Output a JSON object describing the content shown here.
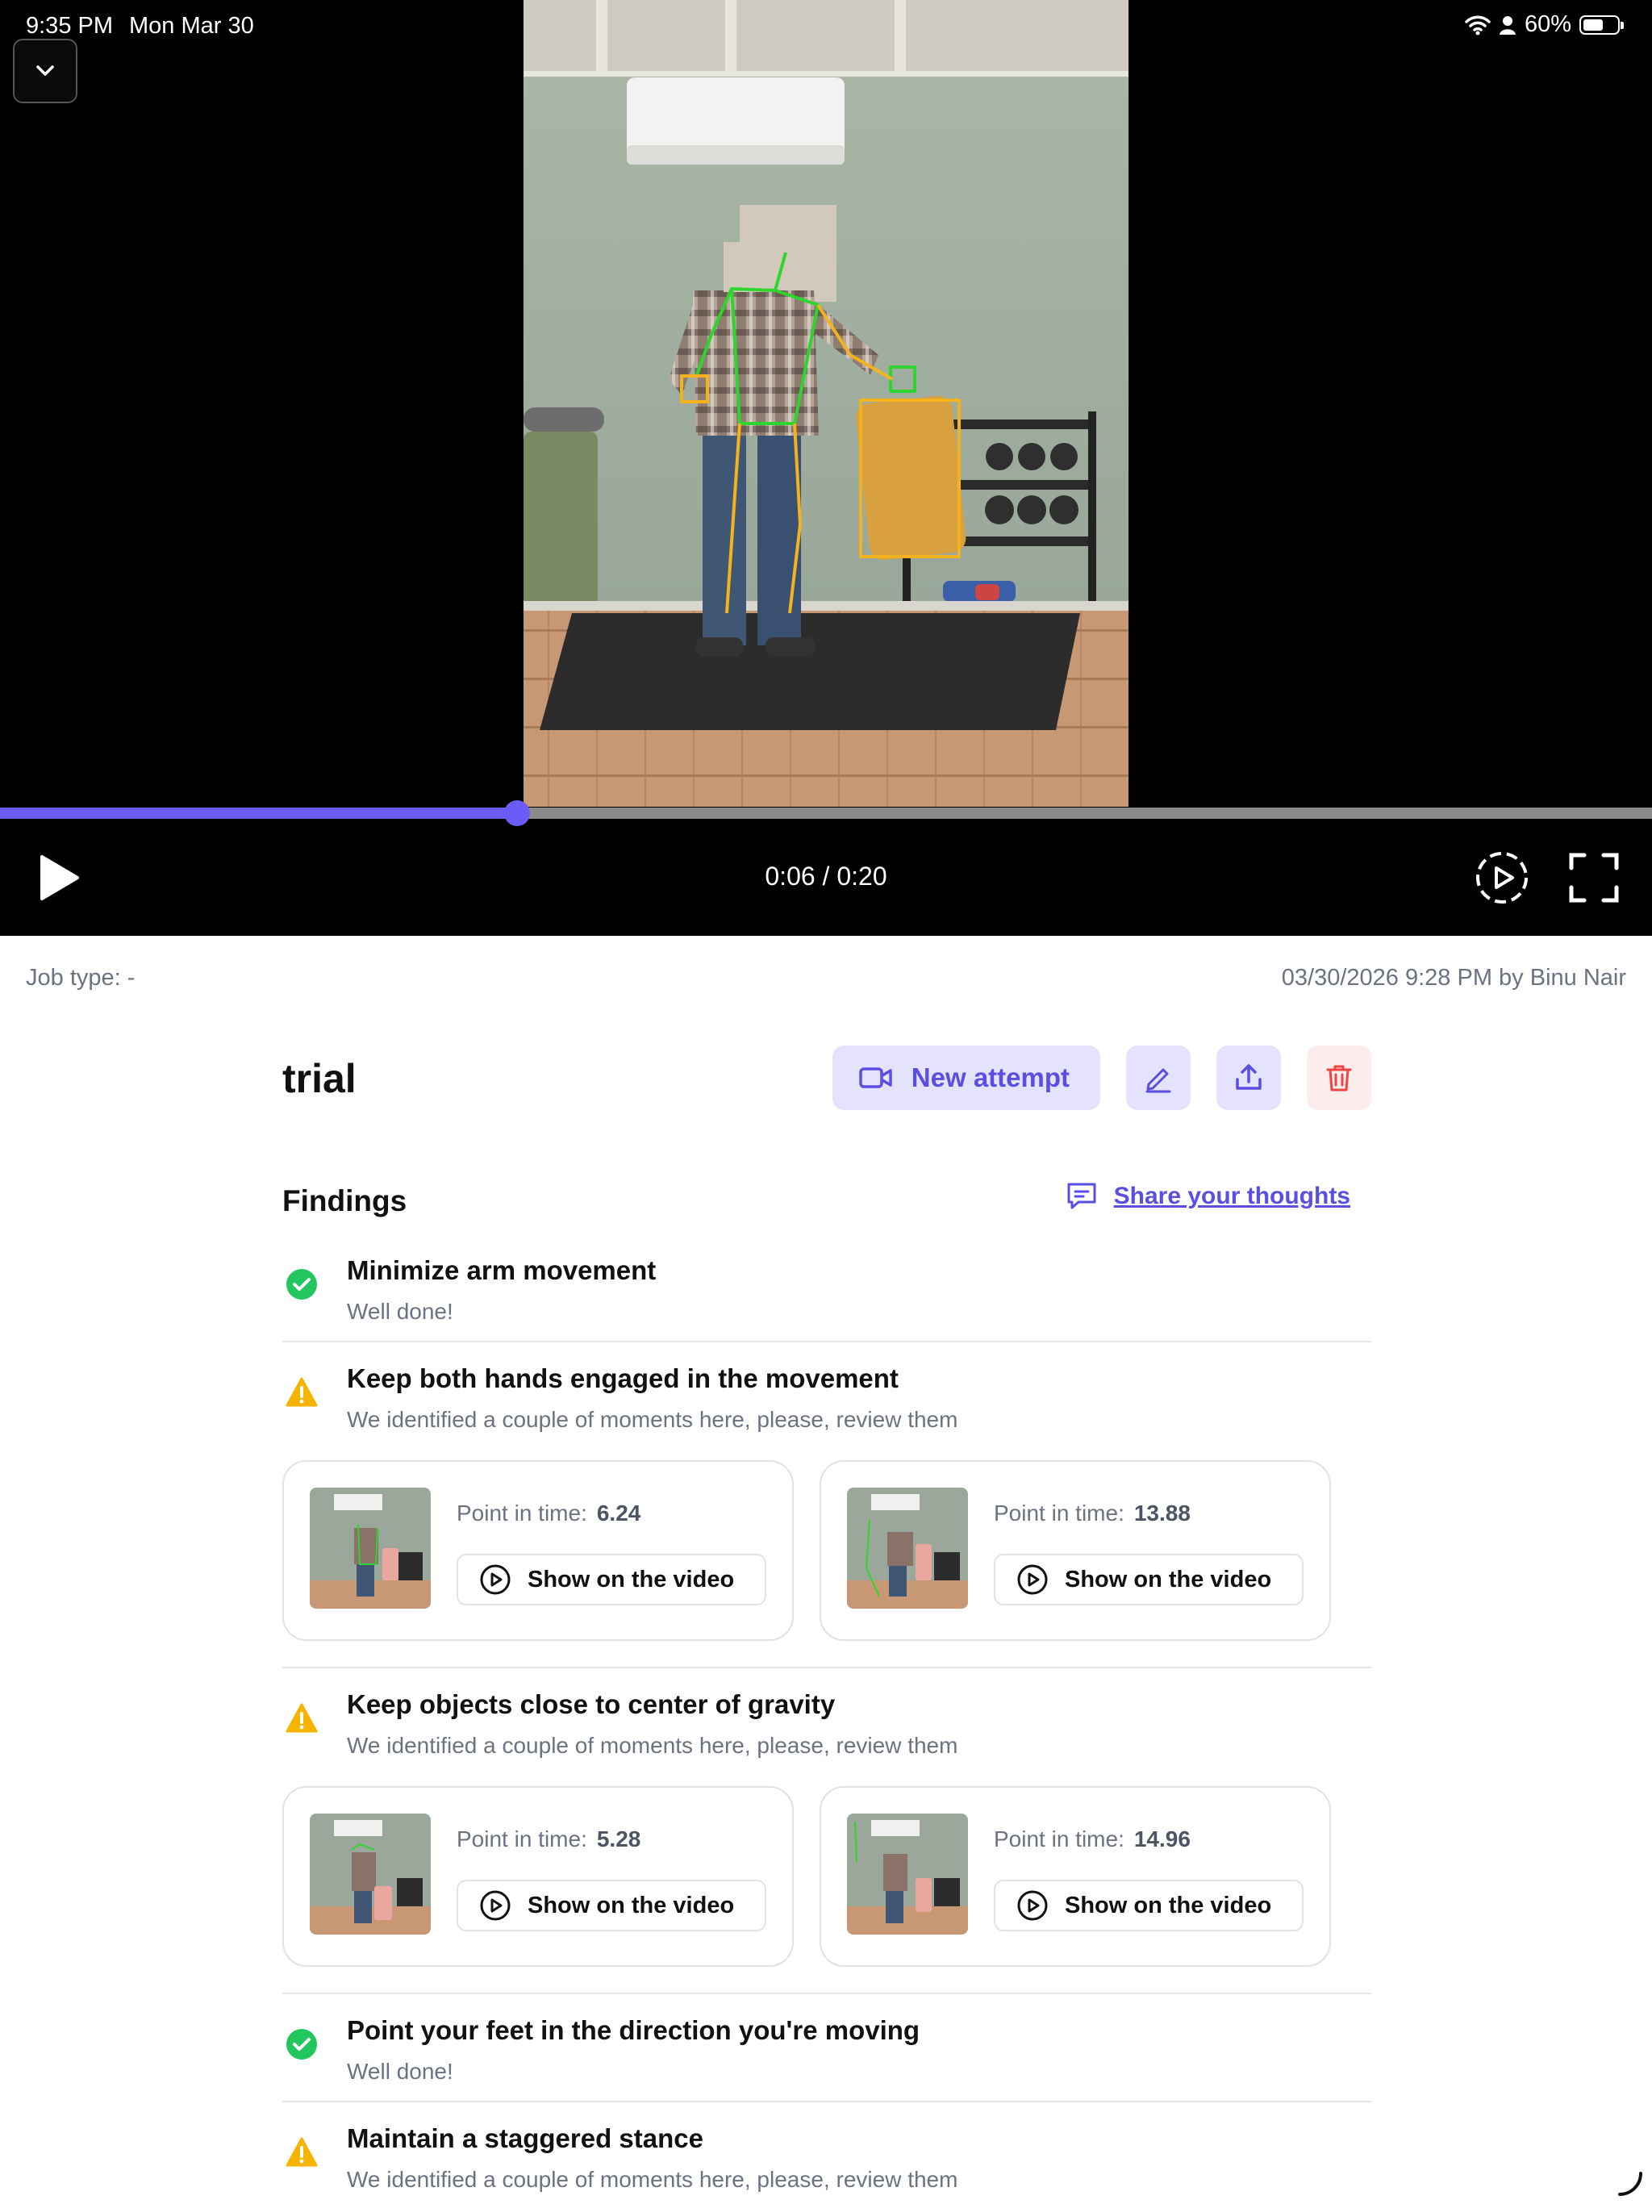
{
  "status_bar": {
    "time": "9:35 PM",
    "date": "Mon Mar 30",
    "battery": "60%",
    "battery_fraction": 0.6,
    "icons": [
      "wifi-icon",
      "person-icon",
      "battery-icon"
    ]
  },
  "player": {
    "collapse_icon": "chevron-down-icon",
    "time_readout": "0:06 / 0:20",
    "progress_fraction": 0.313,
    "accent_color": "#6a5cf5",
    "play_icon": "play-icon",
    "autoplay_icon": "autoplay-icon",
    "fullscreen_icon": "fullscreen-icon"
  },
  "meta": {
    "job_type": "Job type: -",
    "recorded": "03/30/2026 9:28 PM by Binu Nair"
  },
  "page": {
    "title": "trial",
    "new_attempt_label": "New attempt",
    "share_label": "Share your thoughts",
    "findings_title": "Findings"
  },
  "colors": {
    "accent": "#5a4fe0",
    "button_bg": "#e4e2fd",
    "success": "#22c55e",
    "warning": "#f5b400",
    "danger": "#ef4444"
  },
  "findings": [
    {
      "status": "success",
      "title": "Minimize arm movement",
      "subtitle": "Well done!"
    },
    {
      "status": "warning",
      "title": "Keep both hands engaged in the movement",
      "subtitle": "We identified a couple of moments here, please, review them",
      "moments": [
        {
          "label": "Point in time:",
          "value": "6.24",
          "button": "Show on the video"
        },
        {
          "label": "Point in time:",
          "value": "13.88",
          "button": "Show on the video"
        }
      ]
    },
    {
      "status": "warning",
      "title": "Keep objects close to center of gravity",
      "subtitle": "We identified a couple of moments here, please, review them",
      "moments": [
        {
          "label": "Point in time:",
          "value": "5.28",
          "button": "Show on the video"
        },
        {
          "label": "Point in time:",
          "value": "14.96",
          "button": "Show on the video"
        }
      ]
    },
    {
      "status": "success",
      "title": "Point your feet in the direction you're moving",
      "subtitle": "Well done!"
    },
    {
      "status": "warning",
      "title": "Maintain a staggered stance",
      "subtitle": "We identified a couple of moments here, please, review them"
    }
  ]
}
